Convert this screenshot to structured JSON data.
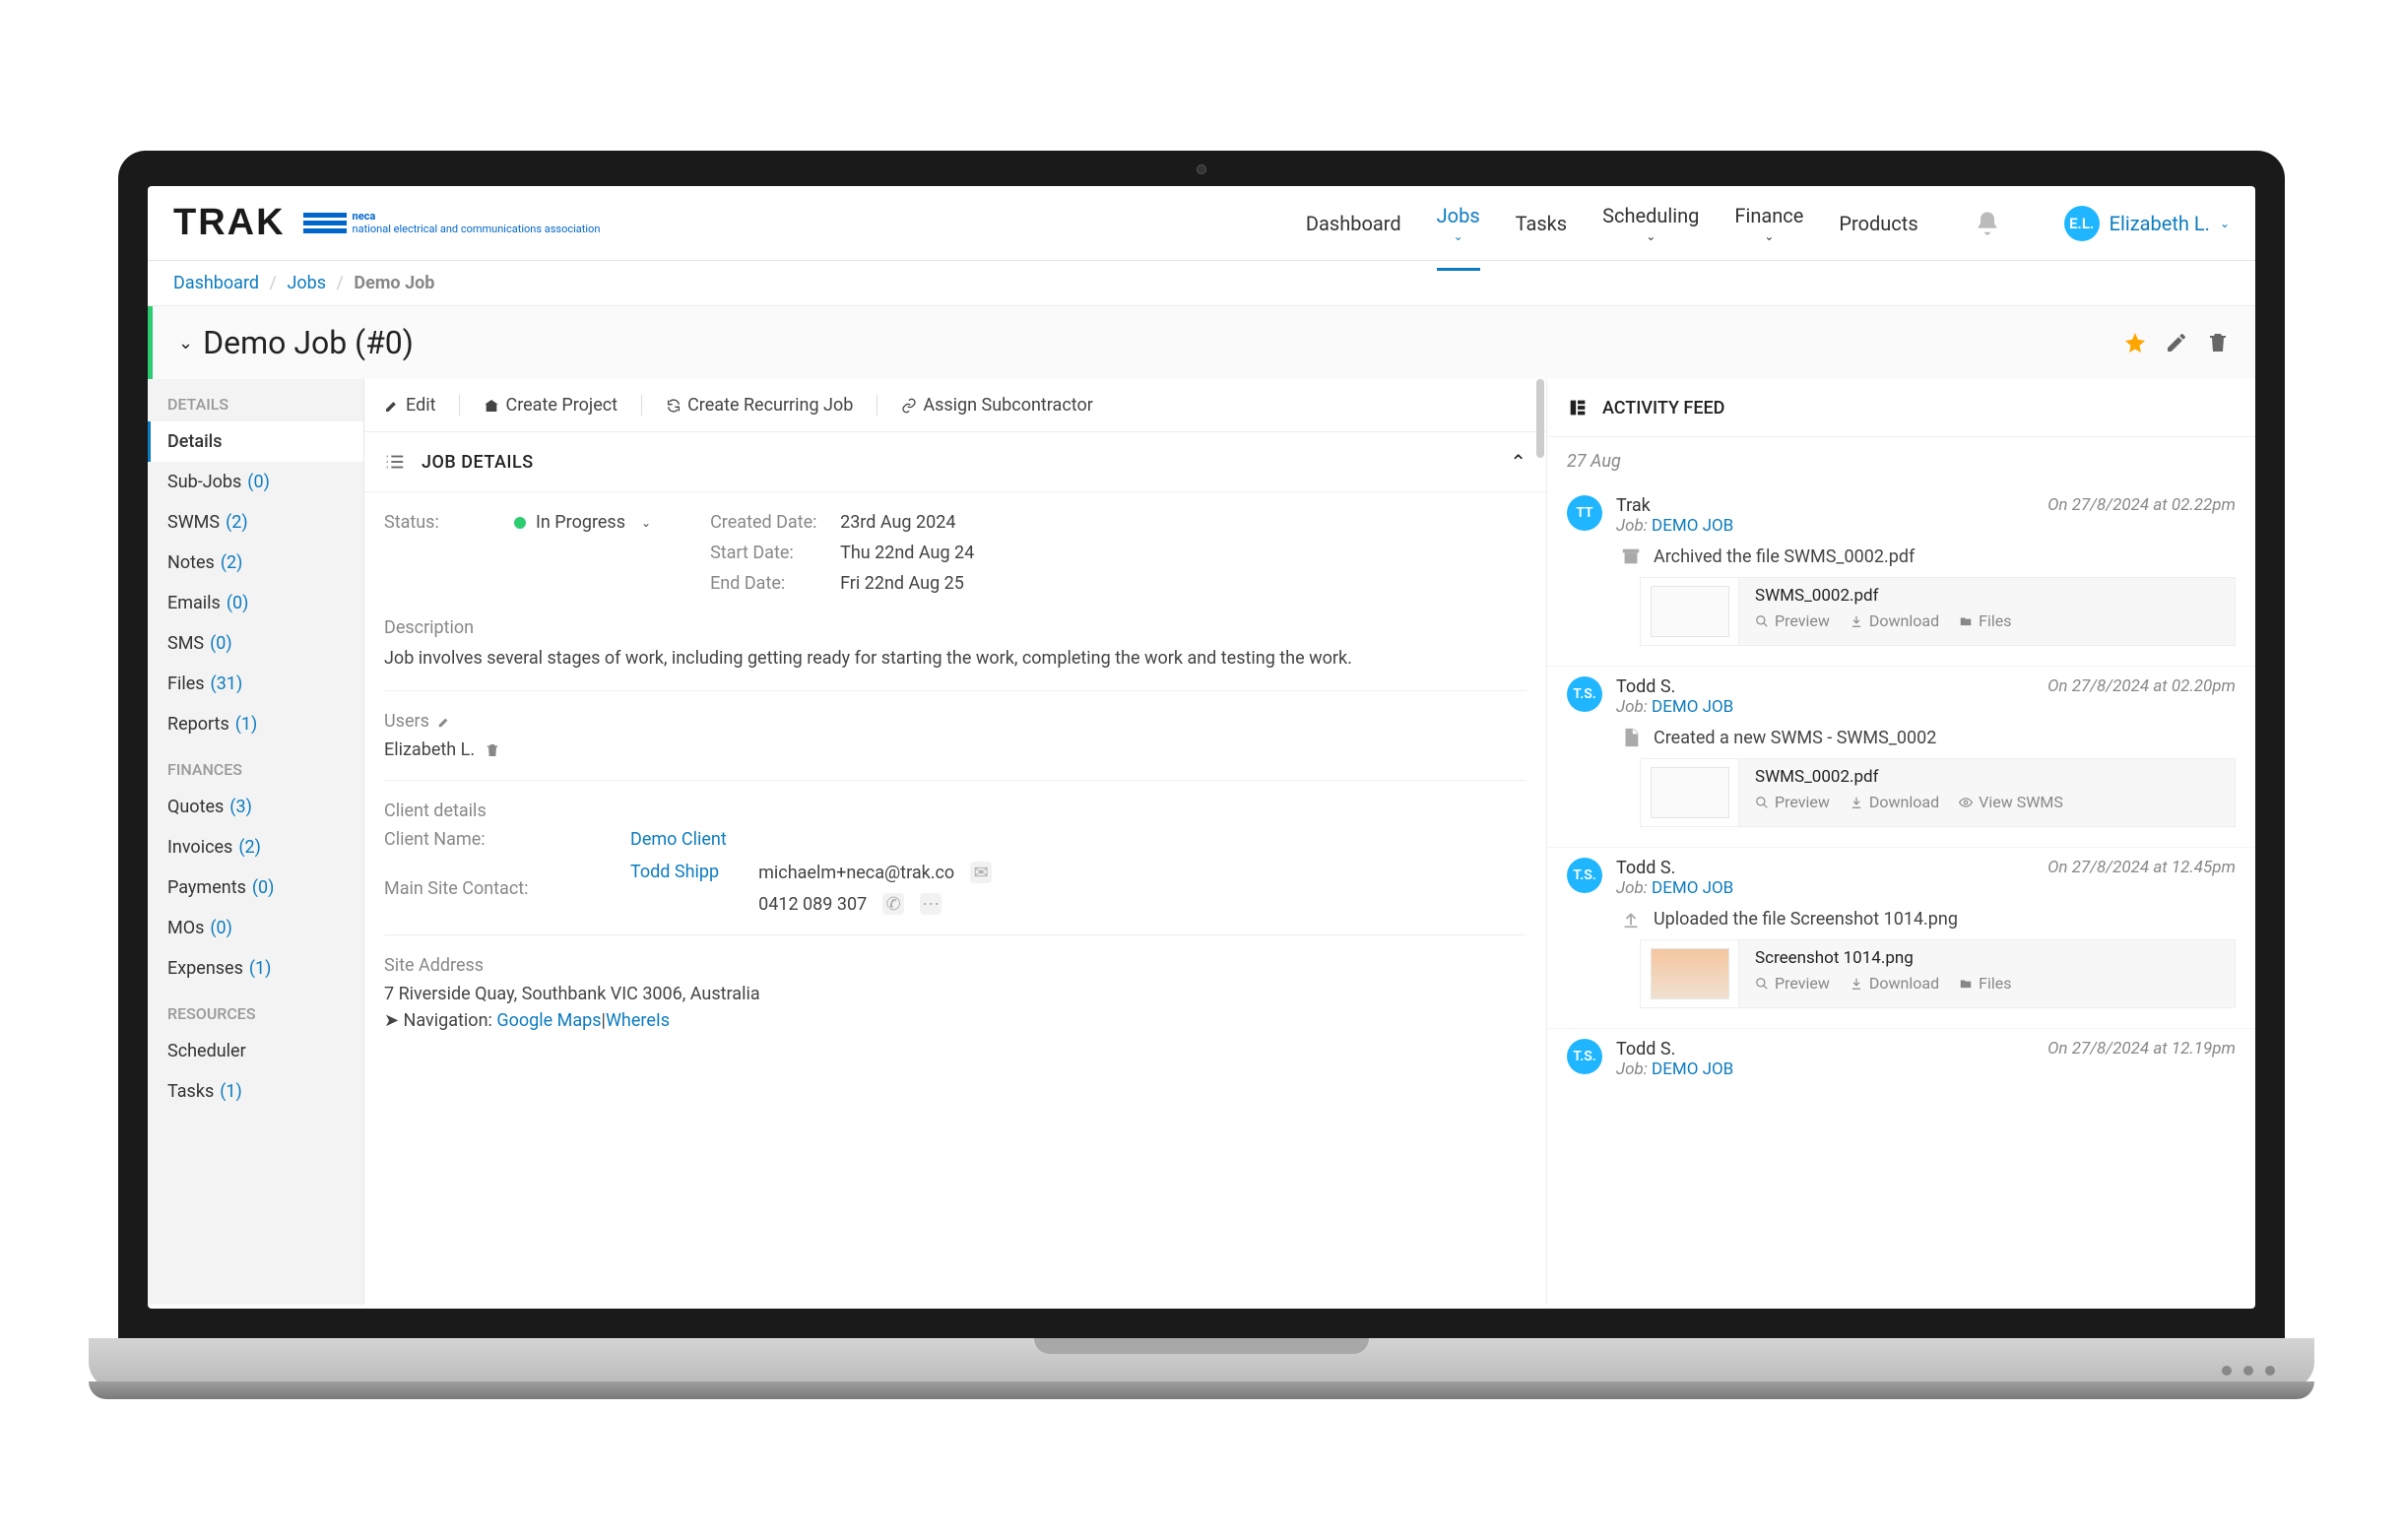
{
  "header": {
    "logo_text": "TRAK",
    "neca_label": "neca",
    "neca_subtitle": "national electrical and communications association",
    "nav": [
      "Dashboard",
      "Jobs",
      "Tasks",
      "Scheduling",
      "Finance",
      "Products"
    ],
    "user_initials": "E.L.",
    "user_name": "Elizabeth L."
  },
  "breadcrumb": [
    "Dashboard",
    "Jobs",
    "Demo Job"
  ],
  "title": "Demo Job (#0)",
  "sidebar": {
    "sections": [
      {
        "label": "DETAILS",
        "items": [
          {
            "label": "Details",
            "count": null,
            "active": true
          },
          {
            "label": "Sub-Jobs",
            "count": "(0)"
          },
          {
            "label": "SWMS",
            "count": "(2)"
          },
          {
            "label": "Notes",
            "count": "(2)"
          },
          {
            "label": "Emails",
            "count": "(0)"
          },
          {
            "label": "SMS",
            "count": "(0)"
          },
          {
            "label": "Files",
            "count": "(31)"
          },
          {
            "label": "Reports",
            "count": "(1)"
          }
        ]
      },
      {
        "label": "FINANCES",
        "items": [
          {
            "label": "Quotes",
            "count": "(3)"
          },
          {
            "label": "Invoices",
            "count": "(2)"
          },
          {
            "label": "Payments",
            "count": "(0)"
          },
          {
            "label": "MOs",
            "count": "(0)"
          },
          {
            "label": "Expenses",
            "count": "(1)"
          }
        ]
      },
      {
        "label": "RESOURCES",
        "items": [
          {
            "label": "Scheduler",
            "count": null
          },
          {
            "label": "Tasks",
            "count": "(1)"
          }
        ]
      }
    ]
  },
  "toolbar": {
    "edit": "Edit",
    "create_project": "Create Project",
    "recurring": "Create Recurring Job",
    "assign": "Assign Subcontractor"
  },
  "job_details": {
    "panel_title": "JOB DETAILS",
    "status_label": "Status:",
    "status_value": "In Progress",
    "created_label": "Created Date:",
    "created_value": "23rd Aug 2024",
    "start_label": "Start Date:",
    "start_value": "Thu 22nd Aug 24",
    "end_label": "End Date:",
    "end_value": "Fri 22nd Aug 25",
    "description_label": "Description",
    "description_text": "Job involves several stages of work, including getting ready for starting the work, completing the work and testing the work.",
    "users_label": "Users",
    "user_name": "Elizabeth L.",
    "client_details_label": "Client details",
    "client_name_label": "Client Name:",
    "client_name_value": "Demo Client",
    "main_contact_label": "Main Site Contact:",
    "main_contact_value": "Todd Shipp",
    "contact_email": "michaelm+neca@trak.co",
    "contact_phone": "0412 089 307",
    "site_address_label": "Site Address",
    "site_address_value": "7 Riverside Quay, Southbank VIC 3006, Australia",
    "navigation_label": "Navigation:",
    "nav_google": "Google Maps",
    "nav_whereis": "WhereIs"
  },
  "activity": {
    "title": "ACTIVITY FEED",
    "date_header": "27 Aug",
    "items": [
      {
        "avatar": "TT",
        "user": "Trak",
        "job_label": "Job:",
        "job_name": "DEMO JOB",
        "time": "On 27/8/2024 at 02.22pm",
        "action": "Archived the file SWMS_0002.pdf",
        "attachment": {
          "name": "SWMS_0002.pdf",
          "actions": [
            "Preview",
            "Download",
            "Files"
          ]
        }
      },
      {
        "avatar": "T.S.",
        "user": "Todd S.",
        "job_label": "Job:",
        "job_name": "DEMO JOB",
        "time": "On 27/8/2024 at 02.20pm",
        "action": "Created a new SWMS - SWMS_0002",
        "attachment": {
          "name": "SWMS_0002.pdf",
          "actions": [
            "Preview",
            "Download",
            "View SWMS"
          ]
        }
      },
      {
        "avatar": "T.S.",
        "user": "Todd S.",
        "job_label": "Job:",
        "job_name": "DEMO JOB",
        "time": "On 27/8/2024 at 12.45pm",
        "action": "Uploaded the file Screenshot 1014.png",
        "attachment": {
          "name": "Screenshot 1014.png",
          "actions": [
            "Preview",
            "Download",
            "Files"
          ]
        }
      },
      {
        "avatar": "T.S.",
        "user": "Todd S.",
        "job_label": "Job:",
        "job_name": "DEMO JOB",
        "time": "On 27/8/2024 at 12.19pm",
        "action": "",
        "attachment": null
      }
    ]
  }
}
